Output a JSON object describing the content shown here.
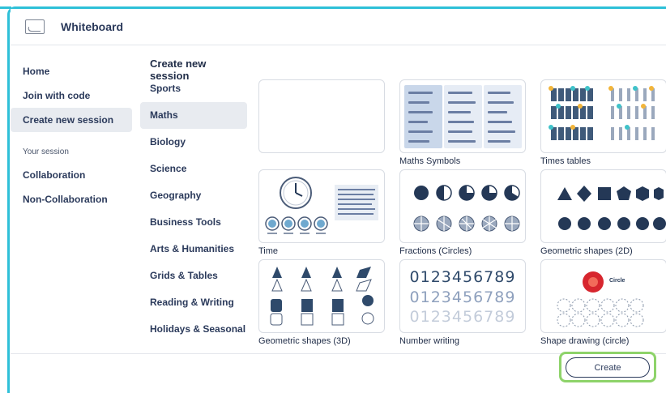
{
  "window": {
    "title": "Whiteboard"
  },
  "sidebar": {
    "items": [
      {
        "label": "Home"
      },
      {
        "label": "Join with code"
      },
      {
        "label": "Create new session",
        "active": true
      }
    ],
    "section_label": "Your session",
    "session_items": [
      {
        "label": "Collaboration"
      },
      {
        "label": "Non-Collaboration"
      }
    ]
  },
  "categories": {
    "heading": "Create new session",
    "items": [
      {
        "label": "Sports"
      },
      {
        "label": "Maths",
        "active": true
      },
      {
        "label": "Biology"
      },
      {
        "label": "Science"
      },
      {
        "label": "Geography"
      },
      {
        "label": "Business Tools"
      },
      {
        "label": "Arts & Humanities"
      },
      {
        "label": "Grids & Tables"
      },
      {
        "label": "Reading & Writing"
      },
      {
        "label": "Holidays & Seasonal"
      }
    ]
  },
  "templates": [
    {
      "label": "",
      "kind": "blank"
    },
    {
      "label": "Maths Symbols",
      "kind": "maths-symbols"
    },
    {
      "label": "Times tables",
      "kind": "times-tables"
    },
    {
      "label": "Time",
      "kind": "time"
    },
    {
      "label": "Fractions (Circles)",
      "kind": "fractions"
    },
    {
      "label": "Geometric shapes (2D)",
      "kind": "shapes-2d"
    },
    {
      "label": "Geometric shapes (3D)",
      "kind": "shapes-3d"
    },
    {
      "label": "Number writing",
      "kind": "number-writing"
    },
    {
      "label": "Shape drawing (circle)",
      "kind": "shape-drawing"
    }
  ],
  "number_writing": {
    "digits": "0123456789"
  },
  "shape_drawing": {
    "badge_text": "Circle"
  },
  "footer": {
    "create_label": "Create"
  },
  "colors": {
    "accent_frame": "#2ec0d8",
    "highlight": "#8ed36a",
    "text_primary": "#2b3a5b",
    "active_bg": "#e8ebf0"
  }
}
